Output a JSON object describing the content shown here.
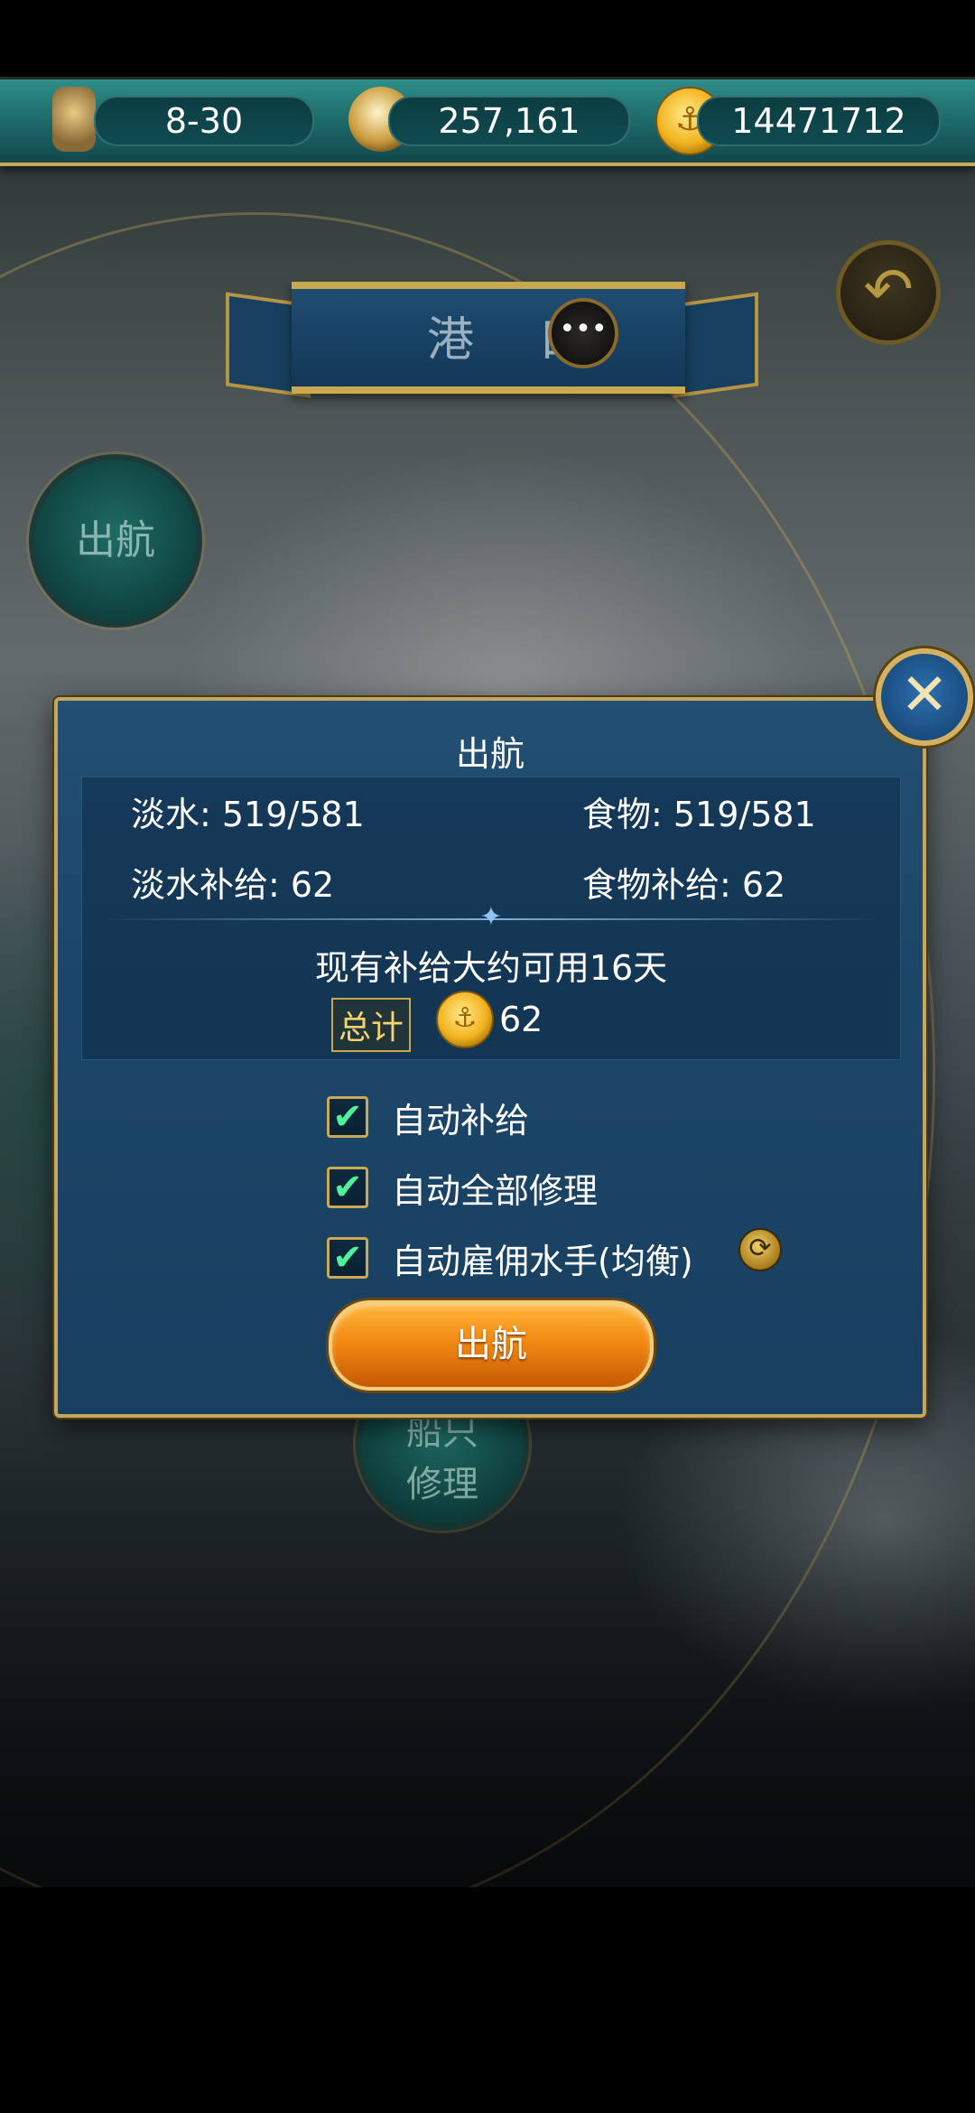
{
  "top_bar": {
    "time_value": "8-30",
    "compass_value": "257,161",
    "coin_value": "14471712",
    "icons": [
      "hourglass-icon",
      "compass-icon",
      "anchor-coin-icon"
    ]
  },
  "header": {
    "title": "港 口",
    "chat_icon": "chat-bubble-icon",
    "back_icon": "back-arrow-icon"
  },
  "background_menu": {
    "sail_button": "出航",
    "repair_button_line1": "船只",
    "repair_button_line2": "修理"
  },
  "dialog": {
    "title": "出航",
    "water_label": "淡水: 519/581",
    "food_label": "食物: 519/581",
    "water_supply_label": "淡水补给: 62",
    "food_supply_label": "食物补给: 62",
    "supply_note": "现有补给大约可用16天",
    "total_label": "总计",
    "total_value": "62",
    "options": [
      {
        "label": "自动补给",
        "checked": true
      },
      {
        "label": "自动全部修理",
        "checked": true
      },
      {
        "label": "自动雇佣水手(均衡)",
        "checked": true
      }
    ],
    "sail_button": "出航",
    "close_icon": "close-x-icon",
    "refresh_icon": "refresh-icon"
  },
  "colors": {
    "accent_gold": "#c9a94f",
    "dialog_bg": "#1c4668",
    "button_orange": "#f28a12",
    "check_green": "#4ff29a"
  }
}
